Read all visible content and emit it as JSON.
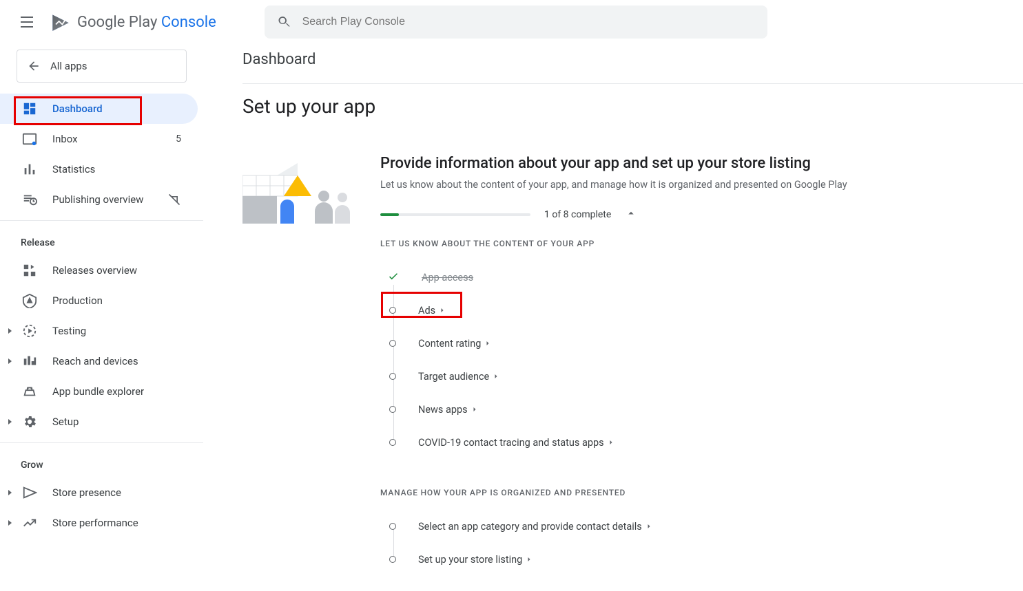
{
  "header": {
    "logo_brand": "Google Play",
    "logo_suffix": "Console",
    "search_placeholder": "Search Play Console"
  },
  "sidebar": {
    "all_apps": "All apps",
    "top": [
      {
        "label": "Dashboard"
      },
      {
        "label": "Inbox",
        "badge": "5"
      },
      {
        "label": "Statistics"
      },
      {
        "label": "Publishing overview"
      }
    ],
    "release_section": "Release",
    "release": [
      {
        "label": "Releases overview"
      },
      {
        "label": "Production"
      },
      {
        "label": "Testing"
      },
      {
        "label": "Reach and devices"
      },
      {
        "label": "App bundle explorer"
      },
      {
        "label": "Setup"
      }
    ],
    "grow_section": "Grow",
    "grow": [
      {
        "label": "Store presence"
      },
      {
        "label": "Store performance"
      }
    ]
  },
  "main": {
    "page_title": "Dashboard",
    "heading": "Set up your app",
    "card_title": "Provide information about your app and set up your store listing",
    "card_desc": "Let us know about the content of your app, and manage how it is organized and presented on Google Play",
    "progress_label": "1 of 8 complete",
    "sub_label_1": "LET US KNOW ABOUT THE CONTENT OF YOUR APP",
    "steps1": [
      {
        "label": "App access",
        "done": true
      },
      {
        "label": "Ads"
      },
      {
        "label": "Content rating"
      },
      {
        "label": "Target audience"
      },
      {
        "label": "News apps"
      },
      {
        "label": "COVID-19 contact tracing and status apps"
      }
    ],
    "sub_label_2": "MANAGE HOW YOUR APP IS ORGANIZED AND PRESENTED",
    "steps2": [
      {
        "label": "Select an app category and provide contact details"
      },
      {
        "label": "Set up your store listing"
      }
    ]
  }
}
